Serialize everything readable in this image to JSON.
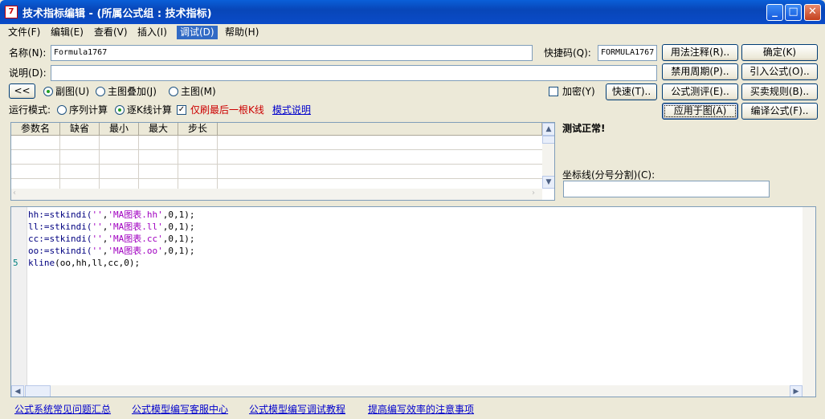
{
  "window": {
    "title": "技术指标编辑 - (所属公式组 : 技术指标)",
    "icon_text": "7",
    "controls": {
      "minimize": "_",
      "maximize": "□",
      "close": "✕"
    }
  },
  "menu": {
    "file": "文件(F)",
    "edit": "编辑(E)",
    "view": "查看(V)",
    "insert": "插入(I)",
    "debug": "调试(D)",
    "help": "帮助(H)"
  },
  "form": {
    "name_label": "名称(N):",
    "name_value": "Formula1767",
    "shortcut_label": "快捷码(Q):",
    "shortcut_value": "FORMULA1767",
    "desc_label": "说明(D):",
    "desc_value": "",
    "collapse_button": "<<",
    "mode_options": [
      "副图(U)",
      "主图叠加(J)",
      "主图(M)"
    ],
    "mode_selected": "副图(U)",
    "encrypt_label": "加密(Y)",
    "encrypt_checked": false,
    "quick_button": "快速(T)..",
    "run_mode_label": "运行模式:",
    "run_options": [
      "序列计算",
      "逐K线计算"
    ],
    "run_selected": "逐K线计算",
    "refresh_last_label": "仅刷最后一根K线",
    "refresh_last_checked": true,
    "mode_help_link": "模式说明"
  },
  "buttons": {
    "usage_notes": "用法注释(R)..",
    "ok": "确定(K)",
    "disable_period": "禁用周期(P)..",
    "import_formula": "引入公式(O)..",
    "formula_test": "公式测评(E)..",
    "trade_rules": "买卖规则(B)..",
    "apply_to_chart": "应用于图(A)",
    "compile_formula": "编译公式(F).."
  },
  "param_table": {
    "headers": [
      "参数名",
      "缺省",
      "最小",
      "最大",
      "步长"
    ],
    "rows": []
  },
  "status": {
    "test_message": "测试正常!",
    "test_color": "#cc0000",
    "axis_label": "坐标线(分号分割)(C):",
    "axis_value": ""
  },
  "code": {
    "lines": [
      {
        "num": "",
        "parts": [
          [
            "hh:=stkindi(",
            "fn"
          ],
          [
            "''",
            "str"
          ],
          [
            ",",
            ""
          ],
          [
            "'MA图表.hh'",
            "str"
          ],
          [
            ",0,1);",
            ""
          ]
        ]
      },
      {
        "num": "",
        "parts": [
          [
            "ll:=stkindi(",
            "fn"
          ],
          [
            "''",
            "str"
          ],
          [
            ",",
            ""
          ],
          [
            "'MA图表.ll'",
            "str"
          ],
          [
            ",0,1);",
            ""
          ]
        ]
      },
      {
        "num": "",
        "parts": [
          [
            "cc:=stkindi(",
            "fn"
          ],
          [
            "''",
            "str"
          ],
          [
            ",",
            ""
          ],
          [
            "'MA图表.cc'",
            "str"
          ],
          [
            ",0,1);",
            ""
          ]
        ]
      },
      {
        "num": "",
        "parts": [
          [
            "oo:=stkindi(",
            "fn"
          ],
          [
            "''",
            "str"
          ],
          [
            ",",
            ""
          ],
          [
            "'MA图表.oo'",
            "str"
          ],
          [
            ",0,1);",
            ""
          ]
        ]
      },
      {
        "num": "5",
        "parts": [
          [
            "kline",
            "fn"
          ],
          [
            "(oo,hh,ll,cc,0);",
            ""
          ]
        ]
      }
    ]
  },
  "footer_links": [
    "公式系统常见问题汇总",
    "公式模型编写客服中心",
    "公式模型编写调试教程",
    "提高编写效率的注意事项"
  ]
}
